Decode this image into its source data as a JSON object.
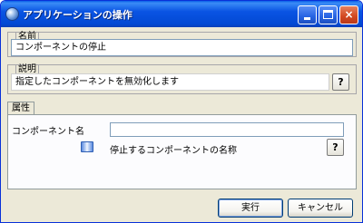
{
  "window": {
    "title": "アプリケーションの操作",
    "icon": "app-globe-icon"
  },
  "title_buttons": {
    "minimize": "minimize-icon",
    "maximize": "maximize-icon",
    "close": "×"
  },
  "name_group": {
    "label": "名前",
    "value": "コンポーネントの停止"
  },
  "description_group": {
    "label": "説明",
    "value": "指定したコンポーネントを無効化します",
    "help": "?"
  },
  "properties": {
    "tab_label": "属性",
    "field_label": "コンポーネント名",
    "field_value": "",
    "description": "停止するコンポーネントの名称",
    "help": "?",
    "desc_icon": "book-icon"
  },
  "buttons": {
    "ok": "実行",
    "cancel": "キャンセル"
  },
  "colors": {
    "titlebar": "#0a54e3",
    "dialog_bg": "#ece9d8",
    "close_button": "#d2471f"
  }
}
